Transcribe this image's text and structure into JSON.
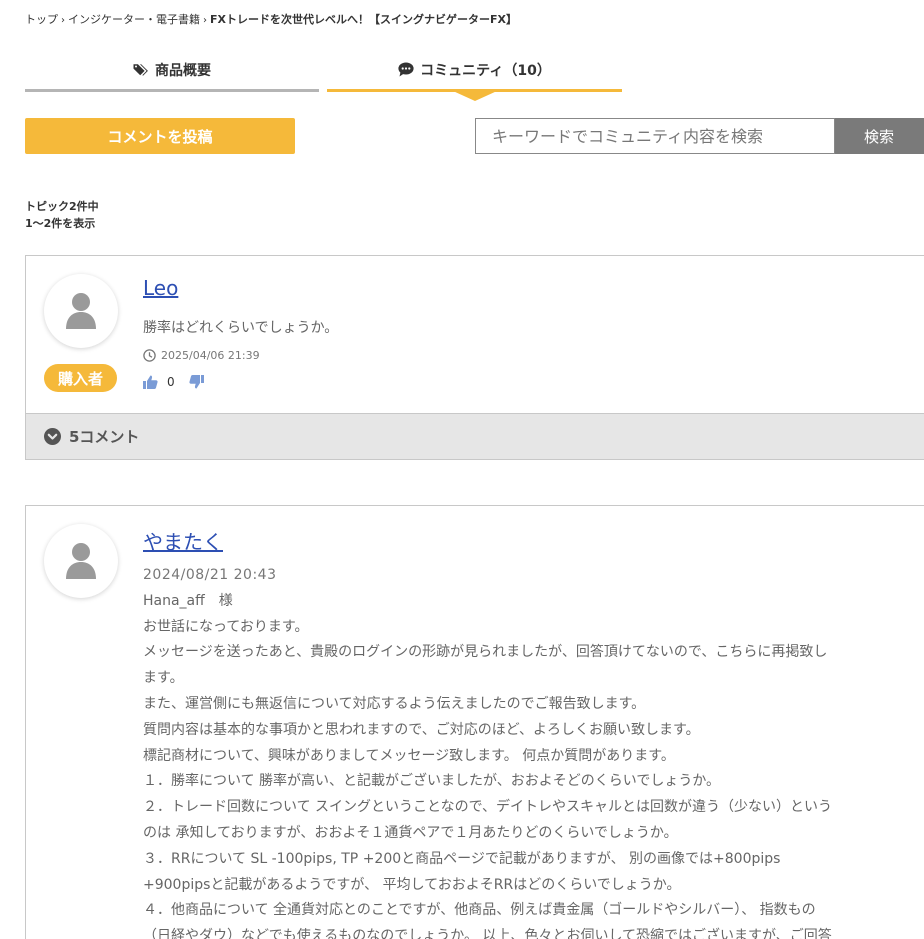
{
  "breadcrumb": {
    "home": "トップ",
    "category": "インジケーター・電子書籍",
    "current": "FXトレードを次世代レベルへ！【スイングナビゲーターFX】",
    "separator": "›"
  },
  "tabs": [
    {
      "label": "商品概要",
      "icon": "tag-icon"
    },
    {
      "label": "コミュニティ（10）",
      "icon": "chat-icon"
    }
  ],
  "post_button": "コメントを投稿",
  "search": {
    "placeholder": "キーワードでコミュニティ内容を検索",
    "button": "検索"
  },
  "topic_count": {
    "line1": "トピック2件中",
    "line2": "1〜2件を表示"
  },
  "topics": [
    {
      "user": "Leo",
      "badge": "購入者",
      "text": "勝率はどれくらいでしょうか。",
      "date": "2025/04/06 21:39",
      "likes": "0",
      "comments": "5コメント"
    },
    {
      "user": "やまたく",
      "date": "2024/08/21 20:43",
      "lines": [
        "Hana_aff　様",
        "お世話になっております。",
        "メッセージを送ったあと、貴殿のログインの形跡が見られましたが、回答頂けてないので、こちらに再掲致し",
        "ます。",
        "また、運営側にも無返信について対応するよう伝えましたのでご報告致します。",
        "質問内容は基本的な事項かと思われますので、ご対応のほど、よろしくお願い致します。",
        "標記商材について、興味がありましてメッセージ致します。 何点か質問があります。",
        "１．勝率について 勝率が高い、と記載がございましたが、おおよそどのくらいでしょうか。",
        "２．トレード回数について スイングということなので、デイトレやスキャルとは回数が違う（少ない）という",
        "のは 承知しておりますが、おおよそ１通貨ペアで１月あたりどのくらいでしょうか。",
        "３．RRについて SL -100pips, TP +200と商品ページで記載がありますが、 別の画像では+800pips",
        "+900pipsと記載があるようですが、 平均しておおよそRRはどのくらいでしょうか。",
        "４．他商品について 全通貨対応とのことですが、他商品、例えば貴金属（ゴールドやシルバー）、 指数もの",
        "（日経やダウ）などでも使えるものなのでしょうか。 以上、色々とお伺いして恐縮ではございますが、ご回答"
      ]
    }
  ],
  "colors": {
    "accent": "#f5b93a",
    "link": "#2d4fb3",
    "search_button": "#7a7a7a",
    "comments_bar": "#e6e6e6"
  }
}
